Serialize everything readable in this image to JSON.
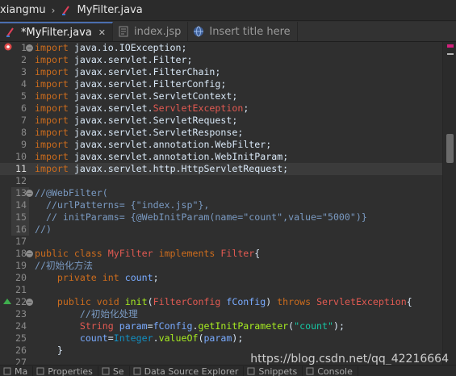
{
  "breadcrumb": {
    "project": "xiangmu",
    "file": "MyFilter.java"
  },
  "tabs": [
    {
      "label": "*MyFilter.java",
      "icon": "java-file-icon",
      "active": true,
      "closable": true
    },
    {
      "label": "index.jsp",
      "icon": "jsp-file-icon",
      "active": false,
      "closable": false
    },
    {
      "label": "Insert title here",
      "icon": "browser-globe-icon",
      "active": false,
      "closable": false
    }
  ],
  "editor": {
    "lines": [
      {
        "n": "1",
        "code": "import java.io.IOException;"
      },
      {
        "n": "2",
        "code": "import javax.servlet.Filter;"
      },
      {
        "n": "3",
        "code": "import javax.servlet.FilterChain;"
      },
      {
        "n": "4",
        "code": "import javax.servlet.FilterConfig;"
      },
      {
        "n": "5",
        "code": "import javax.servlet.ServletContext;"
      },
      {
        "n": "6",
        "code": "import javax.servlet.ServletException;"
      },
      {
        "n": "7",
        "code": "import javax.servlet.ServletRequest;"
      },
      {
        "n": "8",
        "code": "import javax.servlet.ServletResponse;"
      },
      {
        "n": "9",
        "code": "import javax.servlet.annotation.WebFilter;"
      },
      {
        "n": "10",
        "code": "import javax.servlet.annotation.WebInitParam;"
      },
      {
        "n": "11",
        "code": "import javax.servlet.http.HttpServletRequest;"
      },
      {
        "n": "12",
        "code": ""
      },
      {
        "n": "13",
        "code": "//@WebFilter("
      },
      {
        "n": "14",
        "code": "  //urlPatterns= {\"index.jsp\"},"
      },
      {
        "n": "15",
        "code": "  // initParams= {@WebInitParam(name=\"count\",value=\"5000\")}"
      },
      {
        "n": "16",
        "code": "//)"
      },
      {
        "n": "17",
        "code": ""
      },
      {
        "n": "18",
        "code": "public class MyFilter implements Filter{"
      },
      {
        "n": "19",
        "code": "//初始化方法"
      },
      {
        "n": "20",
        "code": "    private int count;"
      },
      {
        "n": "21",
        "code": ""
      },
      {
        "n": "22",
        "code": "    public void init(FilterConfig fConfig) throws ServletException{"
      },
      {
        "n": "23",
        "code": "        //初始化处理"
      },
      {
        "n": "24",
        "code": "        String param=fConfig.getInitParameter(\"count\");"
      },
      {
        "n": "25",
        "code": "        count=Integer.valueOf(param);"
      },
      {
        "n": "26",
        "code": "    }"
      },
      {
        "n": "27",
        "code": ""
      }
    ]
  },
  "watermark": "https://blog.csdn.net/qq_42216664",
  "bottom_tabs": [
    "Ma",
    "Properties",
    "Se",
    "Data Source Explorer",
    "Snippets",
    "Console"
  ],
  "colors": {
    "keyword": "#cc6c1d",
    "string": "#17c6a3",
    "comment": "#7a9ac2",
    "annotation": "#a0a0a0",
    "type": "#1290c3",
    "method": "#a7ec21",
    "accent": "#4b6eaf"
  }
}
